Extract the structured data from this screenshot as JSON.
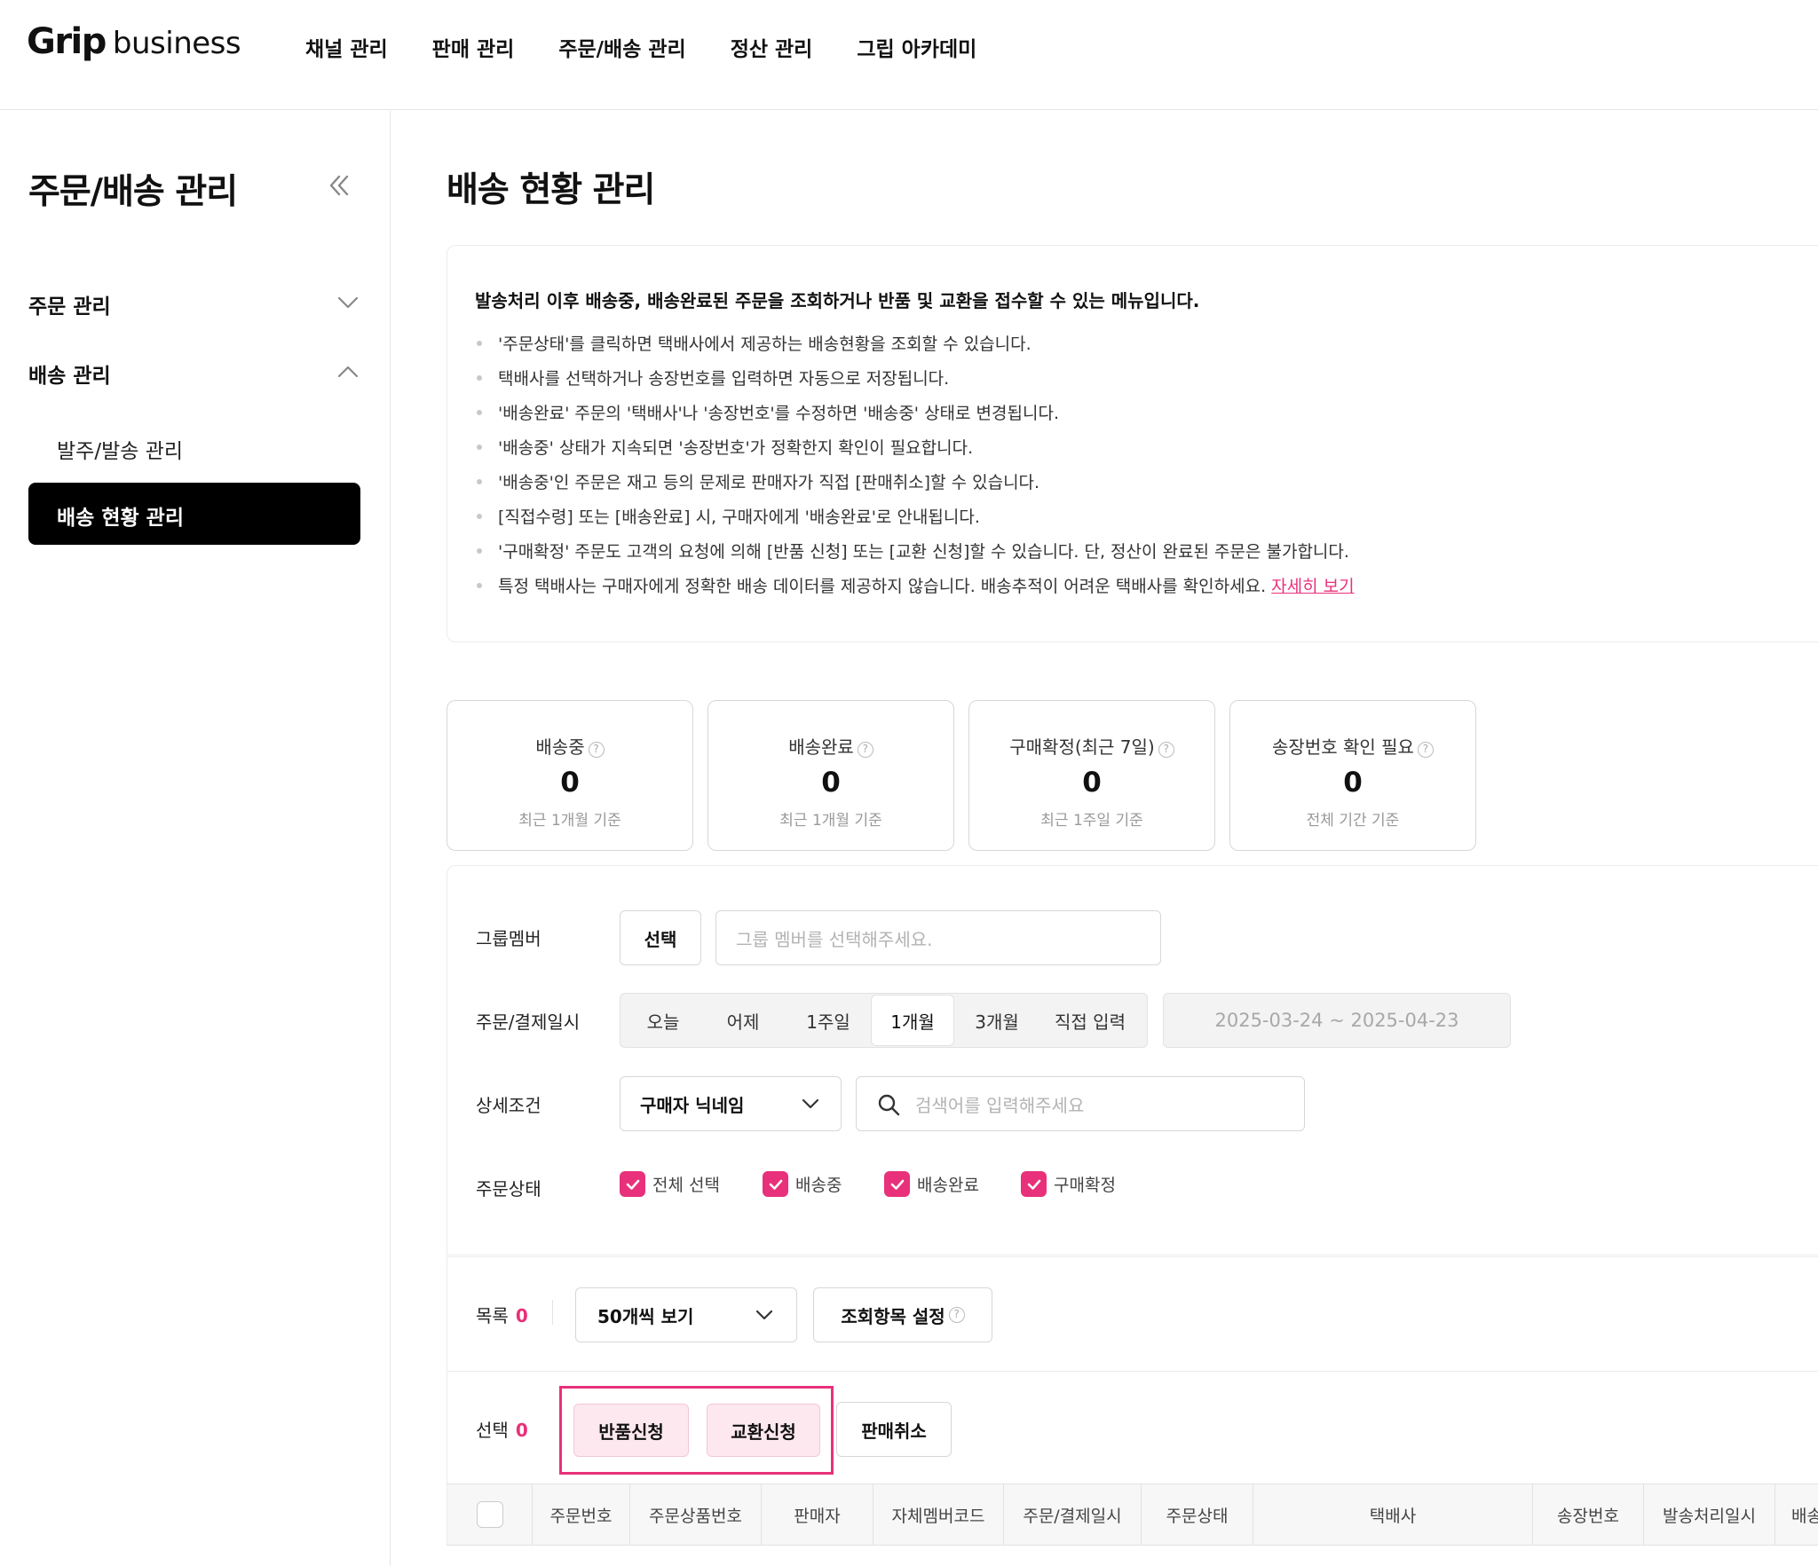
{
  "header": {
    "logo_bold": "Grip",
    "logo_light": "business",
    "nav": [
      "채널 관리",
      "판매 관리",
      "주문/배송 관리",
      "정산 관리",
      "그립 아카데미"
    ]
  },
  "sidebar": {
    "title": "주문/배송 관리",
    "collapse_icon": "double-chevron-left-icon",
    "groups": [
      {
        "label": "주문 관리",
        "state": "collapsed"
      },
      {
        "label": "배송 관리",
        "state": "expanded"
      }
    ],
    "sub_items": [
      "발주/발송 관리",
      "배송 현황 관리"
    ],
    "active_item": "배송 현황 관리"
  },
  "page": {
    "title": "배송 현황 관리"
  },
  "notice": {
    "headline": "발송처리 이후 배송중, 배송완료된 주문을 조회하거나 반품 및 교환을 접수할 수 있는 메뉴입니다.",
    "items": [
      "'주문상태'를 클릭하면 택배사에서 제공하는 배송현황을 조회할 수 있습니다.",
      "택배사를 선택하거나 송장번호를 입력하면 자동으로 저장됩니다.",
      "'배송완료' 주문의 '택배사'나 '송장번호'를 수정하면 '배송중' 상태로 변경됩니다.",
      "'배송중' 상태가 지속되면 '송장번호'가 정확한지 확인이 필요합니다.",
      "'배송중'인 주문은 재고 등의 문제로 판매자가 직접 [판매취소]할 수 있습니다.",
      "[직접수령] 또는 [배송완료] 시, 구매자에게 '배송완료'로 안내됩니다.",
      "'구매확정' 주문도 고객의 요청에 의해 [반품 신청] 또는 [교환 신청]할 수 있습니다. 단, 정산이 완료된 주문은 불가합니다.",
      "특정 택배사는 구매자에게 정확한 배송 데이터를 제공하지 않습니다. 배송추적이 어려운 택배사를 확인하세요."
    ],
    "link_text": "자세히 보기"
  },
  "stats": [
    {
      "title": "배송중",
      "value": "0",
      "sub": "최근 1개월 기준"
    },
    {
      "title": "배송완료",
      "value": "0",
      "sub": "최근 1개월 기준"
    },
    {
      "title": "구매확정(최근 7일)",
      "value": "0",
      "sub": "최근 1주일 기준"
    },
    {
      "title": "송장번호 확인 필요",
      "value": "0",
      "sub": "전체 기간 기준"
    }
  ],
  "filters": {
    "group_member_label": "그룹멤버",
    "select_button": "선택",
    "group_member_placeholder": "그룹 멤버를 선택해주세요.",
    "date_label": "주문/결제일시",
    "date_options": [
      "오늘",
      "어제",
      "1주일",
      "1개월",
      "3개월",
      "직접 입력"
    ],
    "date_selected": "1개월",
    "date_range": "2025-03-24 ~ 2025-04-23",
    "detail_label": "상세조건",
    "detail_select": "구매자 닉네임",
    "search_placeholder": "검색어를 입력해주세요",
    "status_label": "주문상태",
    "status_options": [
      "전체 선택",
      "배송중",
      "배송완료",
      "구매확정"
    ]
  },
  "list": {
    "count_label": "목록",
    "count_value": "0",
    "page_size": "50개씩 보기",
    "columns_button": "조회항목 설정",
    "selected_label": "선택",
    "selected_value": "0",
    "return_button": "반품신청",
    "exchange_button": "교환신청",
    "cancel_button": "판매취소"
  },
  "table": {
    "columns": [
      "주문번호",
      "주문상품번호",
      "판매자",
      "자체멤버코드",
      "주문/결제일시",
      "주문상태",
      "택배사",
      "송장번호",
      "발송처리일시",
      "배송"
    ]
  },
  "colors": {
    "accent": "#e8317a",
    "active_bg": "#000000",
    "pink_button_bg": "#fde8f0"
  }
}
